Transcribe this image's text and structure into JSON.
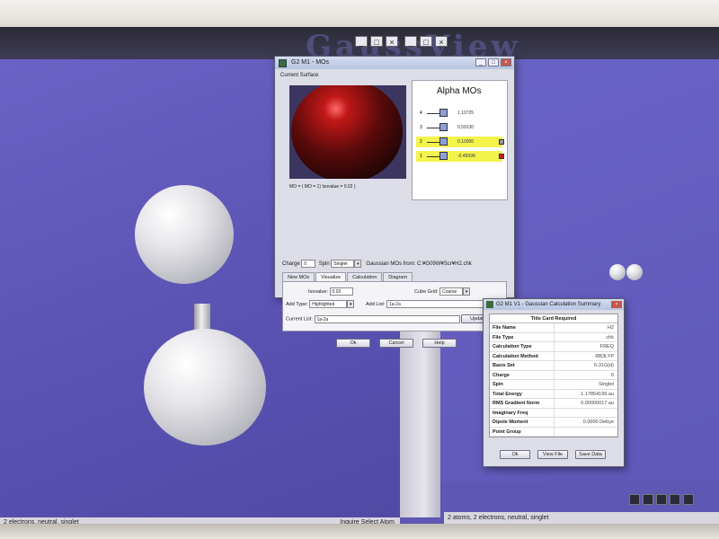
{
  "gaussview": {
    "left_status": "2 electrons, neutral, singlet",
    "left_status_right": "Inquire Select Atom",
    "right_status": "2 atoms, 2 electrons, neutral, singlet"
  },
  "mo_dialog": {
    "title": "G2 M1 - MOs",
    "current_surface_label": "Current Surface",
    "surface_caption": "MO = ( MO = 1) Isovalue = 0.02 )",
    "alpha_title": "Alpha MOs",
    "orbitals": [
      {
        "num": "4",
        "energy": "1.10725",
        "occupied": false
      },
      {
        "num": "3",
        "energy": "0.59130",
        "occupied": false
      },
      {
        "num": "2",
        "energy": "0.10000",
        "occupied": true
      },
      {
        "num": "1",
        "energy": "-0.49398",
        "occupied": true
      }
    ],
    "charge_label": "Charge",
    "charge_value": "0",
    "spin_label": "Spin",
    "spin_value": "Singlet",
    "source_label": "Gaussian MOs from:",
    "source_path": "C:¥G09W¥Scr¥H2.chk",
    "tabs": [
      "New MOs",
      "Visualize",
      "Calculation",
      "Diagram"
    ],
    "isovalue_label": "Isovalue:",
    "isovalue_value": "0.02",
    "cube_grid_label": "Cube Grid:",
    "cube_grid_value": "Coarse",
    "add_type_label": "Add Type:",
    "add_type_value": "Highlighted",
    "add_list_label": "Add List:",
    "add_list_value": "1a-2a",
    "current_list_label": "Current List:",
    "current_list_value": "1a-2a",
    "update_label": "Update",
    "ok_label": "Ok",
    "cancel_label": "Cancel",
    "help_label": "Help"
  },
  "summary_dialog": {
    "title": "G2 M1 V1 - Gaussian Calculation Summary",
    "header": "Title Card Required",
    "rows": [
      {
        "key": "File Name",
        "value": "H2"
      },
      {
        "key": "File Type",
        "value": ".chk"
      },
      {
        "key": "Calculation Type",
        "value": "FREQ"
      },
      {
        "key": "Calculation Method",
        "value": "RB3LYP"
      },
      {
        "key": "Basis Set",
        "value": "6-31G(d)"
      },
      {
        "key": "Charge",
        "value": "0"
      },
      {
        "key": "Spin",
        "value": "Singlet"
      },
      {
        "key": "Total Energy",
        "value": "-1.17854199 au"
      },
      {
        "key": "RMS Gradient Norm",
        "value": "0.00000017 au"
      },
      {
        "key": "Imaginary Freq",
        "value": ""
      },
      {
        "key": "Dipole Moment",
        "value": "0.0000 Debye"
      },
      {
        "key": "Point Group",
        "value": ""
      }
    ],
    "ok_label": "Ok",
    "view_file_label": "View File",
    "save_data_label": "Save Data"
  },
  "colors": {
    "desktop": "#5e57b4",
    "occupied_highlight": "#f3f34c"
  }
}
